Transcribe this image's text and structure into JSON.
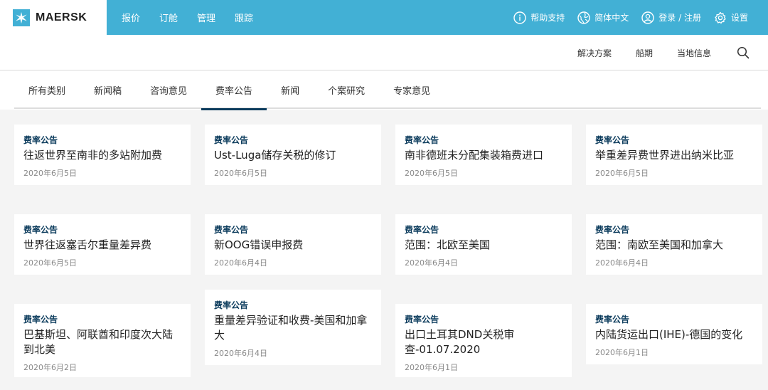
{
  "brand": {
    "name": "MAERSK"
  },
  "main_nav": [
    "报价",
    "订舱",
    "管理",
    "跟踪"
  ],
  "util_nav": {
    "help": "帮助支持",
    "language": "简体中文",
    "login": "登录 / 注册",
    "settings": "设置"
  },
  "second_nav": [
    "解决方案",
    "船期",
    "当地信息"
  ],
  "tabs": [
    "所有类别",
    "新闻稿",
    "咨询意见",
    "费率公告",
    "新闻",
    "个案研究",
    "专家意见"
  ],
  "active_tab": "费率公告",
  "cards": [
    {
      "category": "费率公告",
      "title": "往返世界至南非的多站附加费",
      "date": "2020年6月5日"
    },
    {
      "category": "费率公告",
      "title": "Ust-Luga储存关税的修订",
      "date": "2020年6月5日"
    },
    {
      "category": "费率公告",
      "title": "南非德班未分配集装箱费进口",
      "date": "2020年6月5日"
    },
    {
      "category": "费率公告",
      "title": "举重差异费世界进出纳米比亚",
      "date": "2020年6月5日"
    },
    {
      "category": "费率公告",
      "title": "世界往返塞舌尔重量差异费",
      "date": "2020年6月5日"
    },
    {
      "category": "费率公告",
      "title": "新OOG错误申报费",
      "date": "2020年6月4日"
    },
    {
      "category": "费率公告",
      "title": "范围：北欧至美国",
      "date": "2020年6月4日"
    },
    {
      "category": "费率公告",
      "title": "范围：南欧至美国和加拿大",
      "date": "2020年6月4日"
    },
    {
      "category": "费率公告",
      "title": "巴基斯坦、阿联酋和印度次大陆到北美",
      "date": "2020年6月2日"
    },
    {
      "category": "费率公告",
      "title": "重量差异验证和收费-美国和加拿大",
      "date": "2020年6月4日"
    },
    {
      "category": "费率公告",
      "title": "出口土耳其DND关税审查-01.07.2020",
      "date": "2020年6月1日"
    },
    {
      "category": "费率公告",
      "title": "内陆货运出口(IHE)-德国的变化",
      "date": "2020年6月1日"
    }
  ]
}
